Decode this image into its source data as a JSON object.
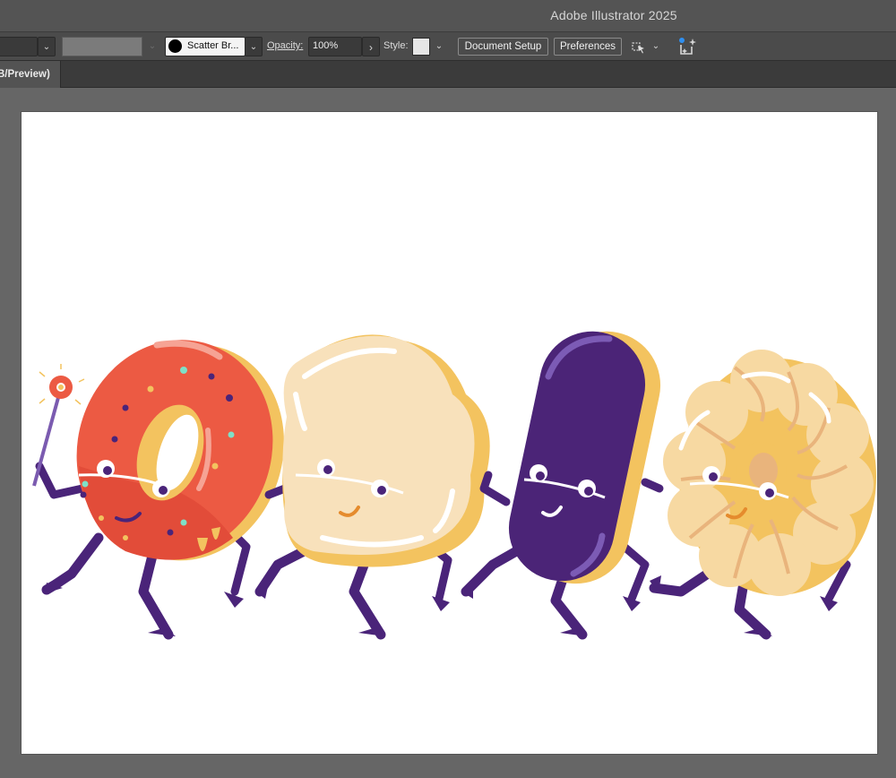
{
  "window": {
    "title": "Adobe Illustrator 2025"
  },
  "control_bar": {
    "brush_name": "Scatter Br...",
    "opacity_label": "Opacity:",
    "opacity_value": "100%",
    "style_label": "Style:",
    "document_setup_label": "Document Setup",
    "preferences_label": "Preferences"
  },
  "document_tab": {
    "label": "B/Preview)"
  },
  "artwork": {
    "characters": [
      "glazed-donut",
      "cream-cookie",
      "eclair",
      "cruller"
    ],
    "colors": {
      "limb_purple": "#4a2479",
      "donut_glaze": "#ec5a43",
      "dough": "#f3c35f",
      "cream": "#f8e1bb",
      "eclair_icing": "#4b2477",
      "cruller": "#f7d9a2"
    }
  }
}
